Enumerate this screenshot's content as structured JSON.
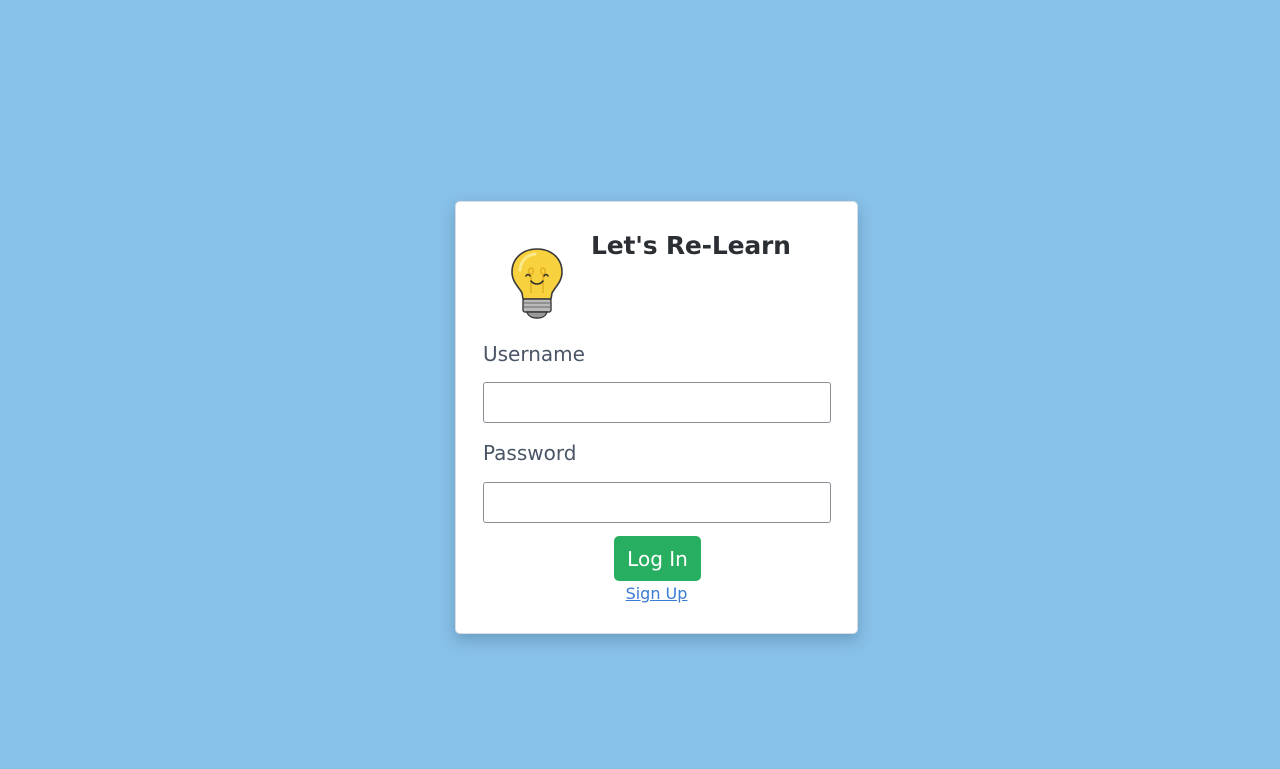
{
  "app": {
    "title": "Let's Re-Learn",
    "logo_icon": "lightbulb-icon"
  },
  "form": {
    "username_label": "Username",
    "username_value": "",
    "password_label": "Password",
    "password_value": "",
    "login_label": "Log In",
    "signup_label": "Sign Up"
  },
  "colors": {
    "background": "#87c0e8",
    "card": "#ffffff",
    "login_button": "#27ae60",
    "signup_link": "#3a7bd5"
  }
}
